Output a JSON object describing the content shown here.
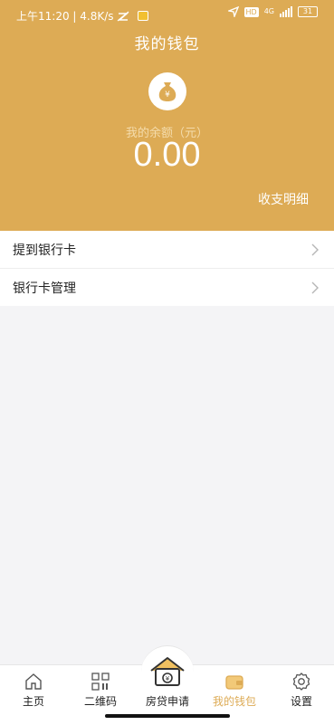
{
  "status_bar": {
    "time_speed": "上午11:20 | 4.8K/s",
    "hd_label": "HD",
    "network_label": "4G",
    "battery": "31"
  },
  "header": {
    "title": "我的钱包",
    "balance_label": "我的余额（元）",
    "balance": "0.00",
    "details_link": "收支明细",
    "coin_symbol": "¥"
  },
  "menu": {
    "items": [
      {
        "label": "提到银行卡"
      },
      {
        "label": "银行卡管理"
      }
    ]
  },
  "tabbar": {
    "tabs": [
      {
        "label": "主页",
        "icon": "home-icon"
      },
      {
        "label": "二维码",
        "icon": "qr-code-icon"
      },
      {
        "label": "房贷申请",
        "icon": "house-loan-icon"
      },
      {
        "label": "我的钱包",
        "icon": "wallet-icon",
        "active": true
      },
      {
        "label": "设置",
        "icon": "gear-icon"
      }
    ],
    "active_color": "#ddab55"
  },
  "colors": {
    "brand": "#ddab55",
    "background": "#f4f4f6"
  }
}
